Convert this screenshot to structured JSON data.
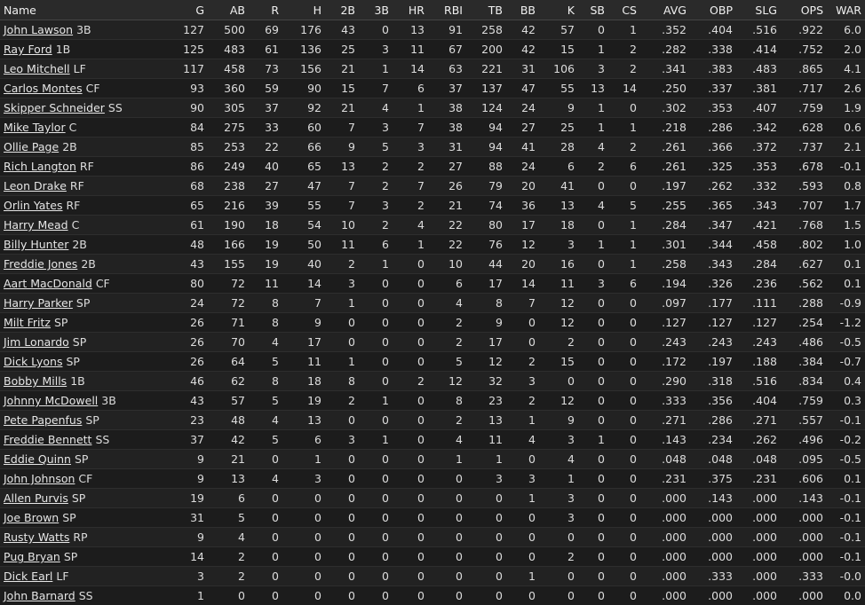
{
  "columns": [
    "Name",
    "G",
    "AB",
    "R",
    "H",
    "2B",
    "3B",
    "HR",
    "RBI",
    "TB",
    "BB",
    "K",
    "SB",
    "CS",
    "AVG",
    "OBP",
    "SLG",
    "OPS",
    "WAR"
  ],
  "rows": [
    {
      "name": "John Lawson",
      "pos": "3B",
      "stats": [
        "127",
        "500",
        "69",
        "176",
        "43",
        "0",
        "13",
        "91",
        "258",
        "42",
        "57",
        "0",
        "1",
        ".352",
        ".404",
        ".516",
        ".922",
        "6.0"
      ]
    },
    {
      "name": "Ray Ford",
      "pos": "1B",
      "stats": [
        "125",
        "483",
        "61",
        "136",
        "25",
        "3",
        "11",
        "67",
        "200",
        "42",
        "15",
        "1",
        "2",
        ".282",
        ".338",
        ".414",
        ".752",
        "2.0"
      ]
    },
    {
      "name": "Leo Mitchell",
      "pos": "LF",
      "stats": [
        "117",
        "458",
        "73",
        "156",
        "21",
        "1",
        "14",
        "63",
        "221",
        "31",
        "106",
        "3",
        "2",
        ".341",
        ".383",
        ".483",
        ".865",
        "4.1"
      ]
    },
    {
      "name": "Carlos Montes",
      "pos": "CF",
      "stats": [
        "93",
        "360",
        "59",
        "90",
        "15",
        "7",
        "6",
        "37",
        "137",
        "47",
        "55",
        "13",
        "14",
        ".250",
        ".337",
        ".381",
        ".717",
        "2.6"
      ]
    },
    {
      "name": "Skipper Schneider",
      "pos": "SS",
      "stats": [
        "90",
        "305",
        "37",
        "92",
        "21",
        "4",
        "1",
        "38",
        "124",
        "24",
        "9",
        "1",
        "0",
        ".302",
        ".353",
        ".407",
        ".759",
        "1.9"
      ]
    },
    {
      "name": "Mike Taylor",
      "pos": "C",
      "stats": [
        "84",
        "275",
        "33",
        "60",
        "7",
        "3",
        "7",
        "38",
        "94",
        "27",
        "25",
        "1",
        "1",
        ".218",
        ".286",
        ".342",
        ".628",
        "0.6"
      ]
    },
    {
      "name": "Ollie Page",
      "pos": "2B",
      "stats": [
        "85",
        "253",
        "22",
        "66",
        "9",
        "5",
        "3",
        "31",
        "94",
        "41",
        "28",
        "4",
        "2",
        ".261",
        ".366",
        ".372",
        ".737",
        "2.1"
      ]
    },
    {
      "name": "Rich Langton",
      "pos": "RF",
      "stats": [
        "86",
        "249",
        "40",
        "65",
        "13",
        "2",
        "2",
        "27",
        "88",
        "24",
        "6",
        "2",
        "6",
        ".261",
        ".325",
        ".353",
        ".678",
        "-0.1"
      ]
    },
    {
      "name": "Leon Drake",
      "pos": "RF",
      "stats": [
        "68",
        "238",
        "27",
        "47",
        "7",
        "2",
        "7",
        "26",
        "79",
        "20",
        "41",
        "0",
        "0",
        ".197",
        ".262",
        ".332",
        ".593",
        "0.8"
      ]
    },
    {
      "name": "Orlin Yates",
      "pos": "RF",
      "stats": [
        "65",
        "216",
        "39",
        "55",
        "7",
        "3",
        "2",
        "21",
        "74",
        "36",
        "13",
        "4",
        "5",
        ".255",
        ".365",
        ".343",
        ".707",
        "1.7"
      ]
    },
    {
      "name": "Harry Mead",
      "pos": "C",
      "stats": [
        "61",
        "190",
        "18",
        "54",
        "10",
        "2",
        "4",
        "22",
        "80",
        "17",
        "18",
        "0",
        "1",
        ".284",
        ".347",
        ".421",
        ".768",
        "1.5"
      ]
    },
    {
      "name": "Billy Hunter",
      "pos": "2B",
      "stats": [
        "48",
        "166",
        "19",
        "50",
        "11",
        "6",
        "1",
        "22",
        "76",
        "12",
        "3",
        "1",
        "1",
        ".301",
        ".344",
        ".458",
        ".802",
        "1.0"
      ]
    },
    {
      "name": "Freddie Jones",
      "pos": "2B",
      "stats": [
        "43",
        "155",
        "19",
        "40",
        "2",
        "1",
        "0",
        "10",
        "44",
        "20",
        "16",
        "0",
        "1",
        ".258",
        ".343",
        ".284",
        ".627",
        "0.1"
      ]
    },
    {
      "name": "Aart MacDonald",
      "pos": "CF",
      "stats": [
        "80",
        "72",
        "11",
        "14",
        "3",
        "0",
        "0",
        "6",
        "17",
        "14",
        "11",
        "3",
        "6",
        ".194",
        ".326",
        ".236",
        ".562",
        "0.1"
      ]
    },
    {
      "name": "Harry Parker",
      "pos": "SP",
      "stats": [
        "24",
        "72",
        "8",
        "7",
        "1",
        "0",
        "0",
        "4",
        "8",
        "7",
        "12",
        "0",
        "0",
        ".097",
        ".177",
        ".111",
        ".288",
        "-0.9"
      ]
    },
    {
      "name": "Milt Fritz",
      "pos": "SP",
      "stats": [
        "26",
        "71",
        "8",
        "9",
        "0",
        "0",
        "0",
        "2",
        "9",
        "0",
        "12",
        "0",
        "0",
        ".127",
        ".127",
        ".127",
        ".254",
        "-1.2"
      ]
    },
    {
      "name": "Jim Lonardo",
      "pos": "SP",
      "stats": [
        "26",
        "70",
        "4",
        "17",
        "0",
        "0",
        "0",
        "2",
        "17",
        "0",
        "2",
        "0",
        "0",
        ".243",
        ".243",
        ".243",
        ".486",
        "-0.5"
      ]
    },
    {
      "name": "Dick Lyons",
      "pos": "SP",
      "stats": [
        "26",
        "64",
        "5",
        "11",
        "1",
        "0",
        "0",
        "5",
        "12",
        "2",
        "15",
        "0",
        "0",
        ".172",
        ".197",
        ".188",
        ".384",
        "-0.7"
      ]
    },
    {
      "name": "Bobby Mills",
      "pos": "1B",
      "stats": [
        "46",
        "62",
        "8",
        "18",
        "8",
        "0",
        "2",
        "12",
        "32",
        "3",
        "0",
        "0",
        "0",
        ".290",
        ".318",
        ".516",
        ".834",
        "0.4"
      ]
    },
    {
      "name": "Johnny McDowell",
      "pos": "3B",
      "stats": [
        "43",
        "57",
        "5",
        "19",
        "2",
        "1",
        "0",
        "8",
        "23",
        "2",
        "12",
        "0",
        "0",
        ".333",
        ".356",
        ".404",
        ".759",
        "0.3"
      ]
    },
    {
      "name": "Pete Papenfus",
      "pos": "SP",
      "stats": [
        "23",
        "48",
        "4",
        "13",
        "0",
        "0",
        "0",
        "2",
        "13",
        "1",
        "9",
        "0",
        "0",
        ".271",
        ".286",
        ".271",
        ".557",
        "-0.1"
      ]
    },
    {
      "name": "Freddie Bennett",
      "pos": "SS",
      "stats": [
        "37",
        "42",
        "5",
        "6",
        "3",
        "1",
        "0",
        "4",
        "11",
        "4",
        "3",
        "1",
        "0",
        ".143",
        ".234",
        ".262",
        ".496",
        "-0.2"
      ]
    },
    {
      "name": "Eddie Quinn",
      "pos": "SP",
      "stats": [
        "9",
        "21",
        "0",
        "1",
        "0",
        "0",
        "0",
        "1",
        "1",
        "0",
        "4",
        "0",
        "0",
        ".048",
        ".048",
        ".048",
        ".095",
        "-0.5"
      ]
    },
    {
      "name": "John Johnson",
      "pos": "CF",
      "stats": [
        "9",
        "13",
        "4",
        "3",
        "0",
        "0",
        "0",
        "0",
        "3",
        "3",
        "1",
        "0",
        "0",
        ".231",
        ".375",
        ".231",
        ".606",
        "0.1"
      ]
    },
    {
      "name": "Allen Purvis",
      "pos": "SP",
      "stats": [
        "19",
        "6",
        "0",
        "0",
        "0",
        "0",
        "0",
        "0",
        "0",
        "1",
        "3",
        "0",
        "0",
        ".000",
        ".143",
        ".000",
        ".143",
        "-0.1"
      ]
    },
    {
      "name": "Joe Brown",
      "pos": "SP",
      "stats": [
        "31",
        "5",
        "0",
        "0",
        "0",
        "0",
        "0",
        "0",
        "0",
        "0",
        "3",
        "0",
        "0",
        ".000",
        ".000",
        ".000",
        ".000",
        "-0.1"
      ]
    },
    {
      "name": "Rusty Watts",
      "pos": "RP",
      "stats": [
        "9",
        "4",
        "0",
        "0",
        "0",
        "0",
        "0",
        "0",
        "0",
        "0",
        "0",
        "0",
        "0",
        ".000",
        ".000",
        ".000",
        ".000",
        "-0.1"
      ]
    },
    {
      "name": "Pug Bryan",
      "pos": "SP",
      "stats": [
        "14",
        "2",
        "0",
        "0",
        "0",
        "0",
        "0",
        "0",
        "0",
        "0",
        "2",
        "0",
        "0",
        ".000",
        ".000",
        ".000",
        ".000",
        "-0.1"
      ]
    },
    {
      "name": "Dick Earl",
      "pos": "LF",
      "stats": [
        "3",
        "2",
        "0",
        "0",
        "0",
        "0",
        "0",
        "0",
        "0",
        "1",
        "0",
        "0",
        "0",
        ".000",
        ".333",
        ".000",
        ".333",
        "-0.0"
      ]
    },
    {
      "name": "John Barnard",
      "pos": "SS",
      "stats": [
        "1",
        "0",
        "0",
        "0",
        "0",
        "0",
        "0",
        "0",
        "0",
        "0",
        "0",
        "0",
        "0",
        ".000",
        ".000",
        ".000",
        ".000",
        "0.0"
      ]
    }
  ]
}
